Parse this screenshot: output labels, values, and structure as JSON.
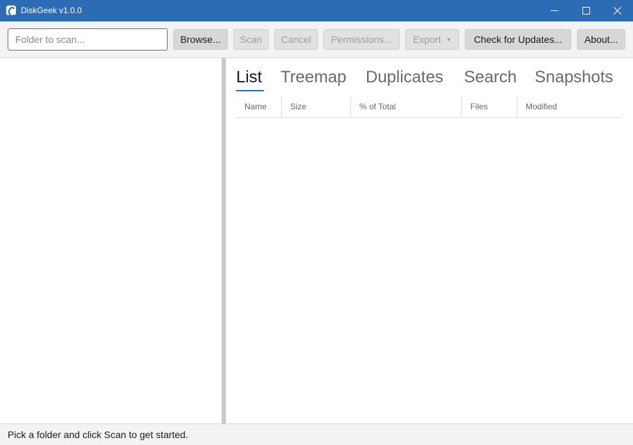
{
  "window": {
    "title": "DiskGeek v1.0.0",
    "accent_color": "#2b6cb4",
    "icon": "app-icon",
    "controls": [
      "minimize-icon",
      "maximize-icon",
      "close-icon"
    ]
  },
  "toolbar": {
    "folder_placeholder": "Folder to scan...",
    "folder_value": "",
    "browse_label": "Browse...",
    "scan_label": "Scan",
    "scan_enabled": false,
    "cancel_label": "Cancel",
    "cancel_enabled": false,
    "permissions_label": "Permissions...",
    "permissions_enabled": false,
    "export_label": "Export",
    "export_enabled": false,
    "export_icon": "dropdown-arrow-icon",
    "updates_label": "Check for Updates...",
    "about_label": "About..."
  },
  "tabs": [
    {
      "label": "List",
      "active": true
    },
    {
      "label": "Treemap",
      "active": false
    },
    {
      "label": "Duplicates",
      "active": false
    },
    {
      "label": "Search",
      "active": false
    },
    {
      "label": "Snapshots",
      "active": false
    }
  ],
  "table": {
    "columns": [
      "Name",
      "Size",
      "% of Total",
      "Files",
      "Modified"
    ],
    "rows": []
  },
  "status": {
    "text": "Pick a folder and click Scan to get started."
  }
}
